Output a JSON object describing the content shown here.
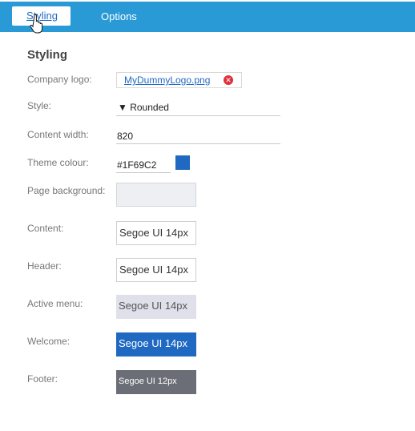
{
  "tabs": [
    {
      "label": "Styling",
      "active": true
    },
    {
      "label": "Options",
      "active": false
    }
  ],
  "section_title": "Styling",
  "fields": {
    "company_logo": {
      "label": "Company logo:",
      "value": "MyDummyLogo.png",
      "remove_icon": "remove-icon"
    },
    "style": {
      "label": "Style:",
      "value": "▼ Rounded"
    },
    "content_width": {
      "label": "Content width:",
      "value": "820"
    },
    "theme_colour": {
      "label": "Theme colour:",
      "value": "#1F69C2",
      "swatch_color": "#1f69c2"
    },
    "page_background": {
      "label": "Page background:",
      "color": "#eeeff2"
    },
    "content": {
      "label": "Content:",
      "value": "Segoe UI 14px",
      "bg": "#ffffff",
      "fg": "#333333"
    },
    "header": {
      "label": "Header:",
      "value": "Segoe UI 14px",
      "bg": "#ffffff",
      "fg": "#333333"
    },
    "active_menu": {
      "label": "Active menu:",
      "value": "Segoe UI 14px",
      "bg": "#dfe0ea",
      "fg": "#555555"
    },
    "welcome": {
      "label": "Welcome:",
      "value": "Segoe UI 14px",
      "bg": "#1f69c2",
      "fg": "#ffffff"
    },
    "footer": {
      "label": "Footer:",
      "value": "Segoe UI 12px",
      "bg": "#6b6e76",
      "fg": "#ffffff"
    }
  },
  "colors": {
    "header_bar": "#2a9ad6",
    "accent": "#1f69c2"
  }
}
